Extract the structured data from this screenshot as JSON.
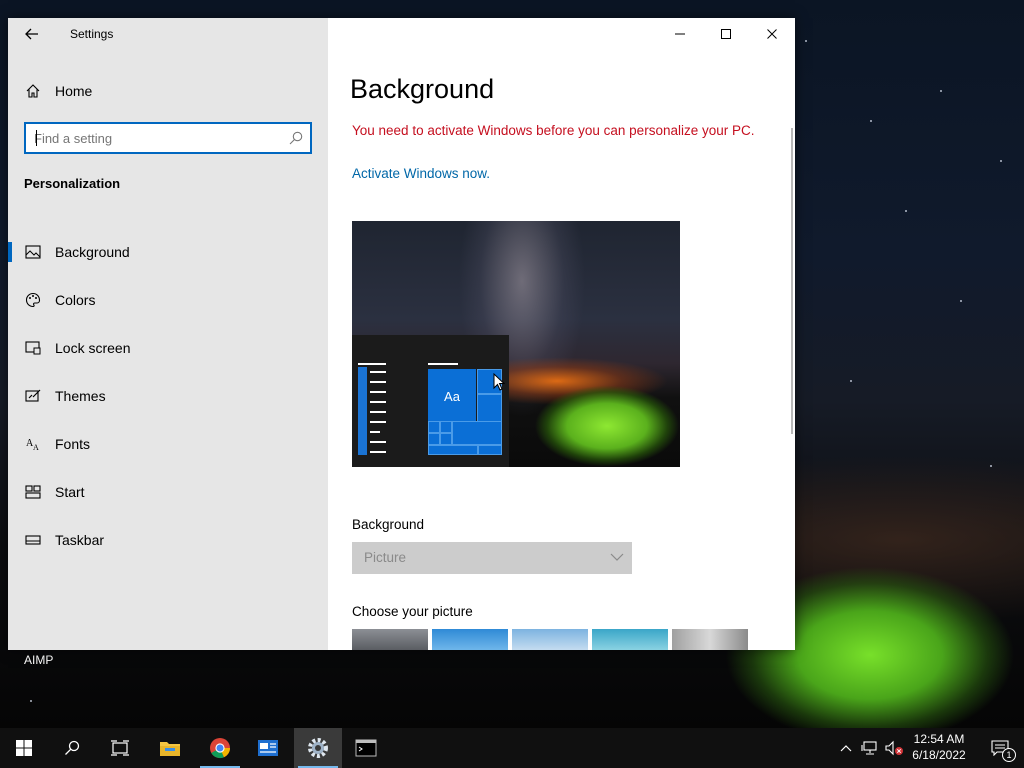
{
  "desktop": {
    "label": "AIMP"
  },
  "window": {
    "title": "Settings",
    "controls": {
      "minimize": "minimize-icon",
      "maximize": "maximize-icon",
      "close": "close-icon"
    }
  },
  "sidebar": {
    "home_label": "Home",
    "search_placeholder": "Find a setting",
    "section_title": "Personalization",
    "items": [
      {
        "label": "Background",
        "icon": "picture-icon",
        "active": true
      },
      {
        "label": "Colors",
        "icon": "palette-icon",
        "active": false
      },
      {
        "label": "Lock screen",
        "icon": "lock-screen-icon",
        "active": false
      },
      {
        "label": "Themes",
        "icon": "themes-icon",
        "active": false
      },
      {
        "label": "Fonts",
        "icon": "fonts-icon",
        "active": false
      },
      {
        "label": "Start",
        "icon": "start-icon",
        "active": false
      },
      {
        "label": "Taskbar",
        "icon": "taskbar-icon",
        "active": false
      }
    ]
  },
  "main": {
    "title": "Background",
    "warning": "You need to activate Windows before you can personalize your PC.",
    "activate_link": "Activate Windows now.",
    "preview": {
      "tile_label": "Aa"
    },
    "background_label": "Background",
    "background_value": "Picture",
    "choose_label": "Choose your picture",
    "picture_thumbs": 5
  },
  "taskbar": {
    "apps": [
      {
        "name": "start",
        "icon": "windows-logo-icon"
      },
      {
        "name": "search",
        "icon": "search-icon"
      },
      {
        "name": "task-view",
        "icon": "task-view-icon"
      },
      {
        "name": "file-explorer",
        "icon": "folder-icon"
      },
      {
        "name": "chrome",
        "icon": "chrome-icon"
      },
      {
        "name": "news",
        "icon": "news-icon"
      },
      {
        "name": "settings",
        "icon": "gear-icon"
      },
      {
        "name": "terminal",
        "icon": "terminal-icon"
      }
    ],
    "time": "12:54 AM",
    "date": "6/18/2022",
    "notification_count": "1"
  },
  "colors": {
    "accent": "#0067c0",
    "warning": "#c50f1f",
    "link": "#0067a8"
  }
}
